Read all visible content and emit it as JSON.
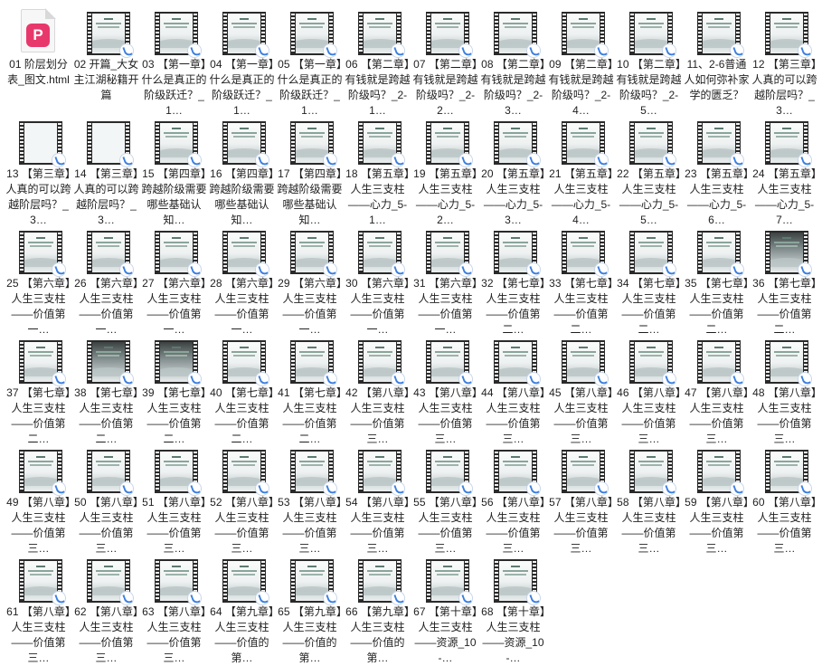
{
  "files": [
    {
      "label": "01 阶层划分表_图文.html",
      "type": "html"
    },
    {
      "label": "02 开篇_大女主江湖秘籍开篇",
      "type": "video"
    },
    {
      "label": "03 【第一章】什么是真正的阶级跃迁？_1…",
      "type": "video"
    },
    {
      "label": "04 【第一章】什么是真正的阶级跃迁？_1…",
      "type": "video"
    },
    {
      "label": "05 【第一章】什么是真正的阶级跃迁？_1…",
      "type": "video"
    },
    {
      "label": "06 【第二章】有钱就是跨越阶级吗？_2-1…",
      "type": "video"
    },
    {
      "label": "07 【第二章】有钱就是跨越阶级吗？_2-2…",
      "type": "video"
    },
    {
      "label": "08 【第二章】有钱就是跨越阶级吗？_2-3…",
      "type": "video"
    },
    {
      "label": "09 【第二章】有钱就是跨越阶级吗？_2-4…",
      "type": "video"
    },
    {
      "label": "10 【第二章】有钱就是跨越阶级吗？_2-5…",
      "type": "video"
    },
    {
      "label": "11、2-6普通人如何弥补家学的匮乏？",
      "type": "video"
    },
    {
      "label": "12 【第三章】人真的可以跨越阶层吗？_3…",
      "type": "video"
    },
    {
      "label": "13 【第三章】人真的可以跨越阶层吗？_3…",
      "type": "video-blank"
    },
    {
      "label": "14 【第三章】人真的可以跨越阶层吗？_3…",
      "type": "video-blank"
    },
    {
      "label": "15 【第四章】跨越阶级需要哪些基础认知…",
      "type": "video"
    },
    {
      "label": "16 【第四章】跨越阶级需要哪些基础认知…",
      "type": "video"
    },
    {
      "label": "17 【第四章】跨越阶级需要哪些基础认知…",
      "type": "video"
    },
    {
      "label": "18 【第五章】人生三支柱——心力_5-1…",
      "type": "video"
    },
    {
      "label": "19 【第五章】人生三支柱——心力_5-2…",
      "type": "video"
    },
    {
      "label": "20 【第五章】人生三支柱——心力_5-3…",
      "type": "video"
    },
    {
      "label": "21 【第五章】人生三支柱——心力_5-4…",
      "type": "video"
    },
    {
      "label": "22 【第五章】人生三支柱——心力_5-5…",
      "type": "video"
    },
    {
      "label": "23 【第五章】人生三支柱——心力_5-6…",
      "type": "video"
    },
    {
      "label": "24 【第五章】人生三支柱——心力_5-7…",
      "type": "video"
    },
    {
      "label": "25 【第六章】人生三支柱——价值第一…",
      "type": "video"
    },
    {
      "label": "26 【第六章】人生三支柱——价值第一…",
      "type": "video"
    },
    {
      "label": "27 【第六章】人生三支柱——价值第一…",
      "type": "video"
    },
    {
      "label": "28 【第六章】人生三支柱——价值第一…",
      "type": "video"
    },
    {
      "label": "29 【第六章】人生三支柱——价值第一…",
      "type": "video"
    },
    {
      "label": "30 【第六章】人生三支柱——价值第一…",
      "type": "video"
    },
    {
      "label": "31 【第六章】人生三支柱——价值第一…",
      "type": "video"
    },
    {
      "label": "32 【第七章】人生三支柱——价值第二…",
      "type": "video"
    },
    {
      "label": "33 【第七章】人生三支柱——价值第二…",
      "type": "video"
    },
    {
      "label": "34 【第七章】人生三支柱——价值第二…",
      "type": "video"
    },
    {
      "label": "35 【第七章】人生三支柱——价值第二…",
      "type": "video"
    },
    {
      "label": "36 【第七章】人生三支柱——价值第二…",
      "type": "video-dark"
    },
    {
      "label": "37 【第七章】人生三支柱——价值第二…",
      "type": "video"
    },
    {
      "label": "38 【第七章】人生三支柱——价值第二…",
      "type": "video-dark"
    },
    {
      "label": "39 【第七章】人生三支柱——价值第二…",
      "type": "video-dark"
    },
    {
      "label": "40 【第七章】人生三支柱——价值第二…",
      "type": "video"
    },
    {
      "label": "41 【第七章】人生三支柱——价值第二…",
      "type": "video"
    },
    {
      "label": "42 【第八章】人生三支柱——价值第三…",
      "type": "video"
    },
    {
      "label": "43 【第八章】人生三支柱——价值第三…",
      "type": "video"
    },
    {
      "label": "44 【第八章】人生三支柱——价值第三…",
      "type": "video"
    },
    {
      "label": "45 【第八章】人生三支柱——价值第三…",
      "type": "video"
    },
    {
      "label": "46 【第八章】人生三支柱——价值第三…",
      "type": "video"
    },
    {
      "label": "47 【第八章】人生三支柱——价值第三…",
      "type": "video"
    },
    {
      "label": "48 【第八章】人生三支柱——价值第三…",
      "type": "video"
    },
    {
      "label": "49 【第八章】人生三支柱——价值第三…",
      "type": "video"
    },
    {
      "label": "50 【第八章】人生三支柱——价值第三…",
      "type": "video"
    },
    {
      "label": "51 【第八章】人生三支柱——价值第三…",
      "type": "video"
    },
    {
      "label": "52 【第八章】人生三支柱——价值第三…",
      "type": "video"
    },
    {
      "label": "53 【第八章】人生三支柱——价值第三…",
      "type": "video"
    },
    {
      "label": "54 【第八章】人生三支柱——价值第三…",
      "type": "video"
    },
    {
      "label": "55 【第八章】人生三支柱——价值第三…",
      "type": "video"
    },
    {
      "label": "56 【第八章】人生三支柱——价值第三…",
      "type": "video"
    },
    {
      "label": "57 【第八章】人生三支柱——价值第三…",
      "type": "video"
    },
    {
      "label": "58 【第八章】人生三支柱——价值第三…",
      "type": "video"
    },
    {
      "label": "59 【第八章】人生三支柱——价值第三…",
      "type": "video"
    },
    {
      "label": "60 【第八章】人生三支柱——价值第三…",
      "type": "video"
    },
    {
      "label": "61 【第八章】人生三支柱——价值第三…",
      "type": "video"
    },
    {
      "label": "62 【第八章】人生三支柱——价值第三…",
      "type": "video"
    },
    {
      "label": "63 【第八章】人生三支柱——价值第三…",
      "type": "video"
    },
    {
      "label": "64 【第九章】人生三支柱——价值的第…",
      "type": "video"
    },
    {
      "label": "65 【第九章】人生三支柱——价值的第…",
      "type": "video"
    },
    {
      "label": "66 【第九章】人生三支柱——价值的第…",
      "type": "video"
    },
    {
      "label": "67 【第十章】人生三支柱——资源_10-…",
      "type": "video"
    },
    {
      "label": "68 【第十章】人生三支柱——资源_10-…",
      "type": "video"
    }
  ]
}
